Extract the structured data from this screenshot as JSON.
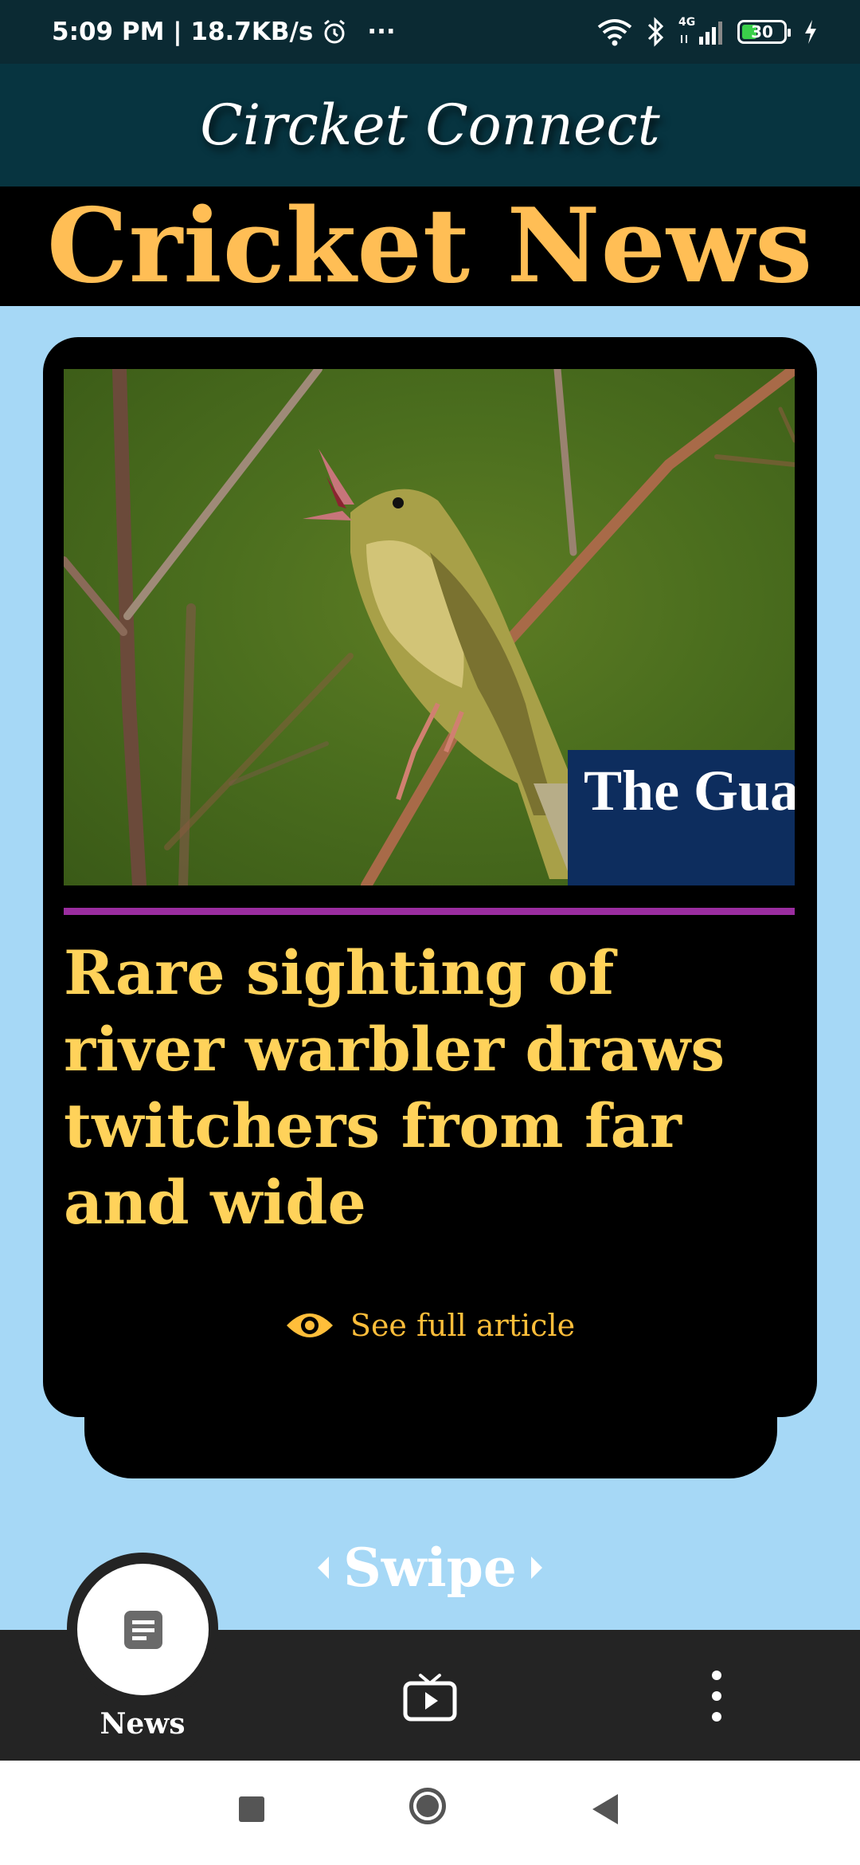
{
  "status_bar": {
    "time_speed": "5:09 PM | 18.7KB/s",
    "more": "···",
    "network": "4G",
    "battery": "30"
  },
  "app": {
    "title": "Circket Connect"
  },
  "banner": {
    "title": "Cricket News"
  },
  "article": {
    "source_logo": "The Guardian",
    "headline": "Rare sighting of river warbler draws twitchers from far and wide",
    "see_full": "See full article"
  },
  "swipe": {
    "label": "Swipe"
  },
  "bottom_nav": {
    "items": [
      {
        "label": "News",
        "icon": "article-icon",
        "active": true
      },
      {
        "label": "",
        "icon": "tv-icon",
        "active": false
      },
      {
        "label": "",
        "icon": "more-vertical-icon",
        "active": false
      }
    ]
  },
  "colors": {
    "page_bg": "#a6d8f6",
    "appbar": "#073440",
    "banner_text": "#ffbe55",
    "headline": "#ffd25a",
    "divider": "#9a2d9f",
    "link": "#ffbe3a"
  }
}
